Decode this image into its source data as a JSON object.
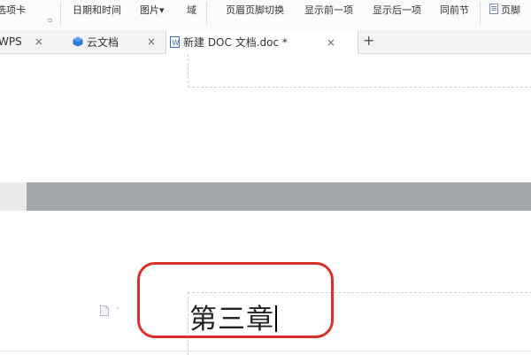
{
  "ribbon": {
    "items": [
      "选项卡",
      "日期和时间",
      "图片▾",
      "域",
      "页眉页脚切换",
      "显示前一项",
      "显示后一项",
      "同前节",
      "页脚"
    ],
    "sub_icon": "▫"
  },
  "tabs": [
    {
      "label": "WPS",
      "close": "×"
    },
    {
      "label": "云文档",
      "close": "×",
      "icon": "cloud-icon"
    },
    {
      "label": "新建 DOC 文档.doc *",
      "close": "×",
      "icon": "doc-icon",
      "active": true
    }
  ],
  "new_tab": "+",
  "document": {
    "heading": "第三章",
    "paragraph_marker": "-"
  },
  "colors": {
    "highlight": "#d9302c",
    "gap": "#a3a6ab"
  }
}
